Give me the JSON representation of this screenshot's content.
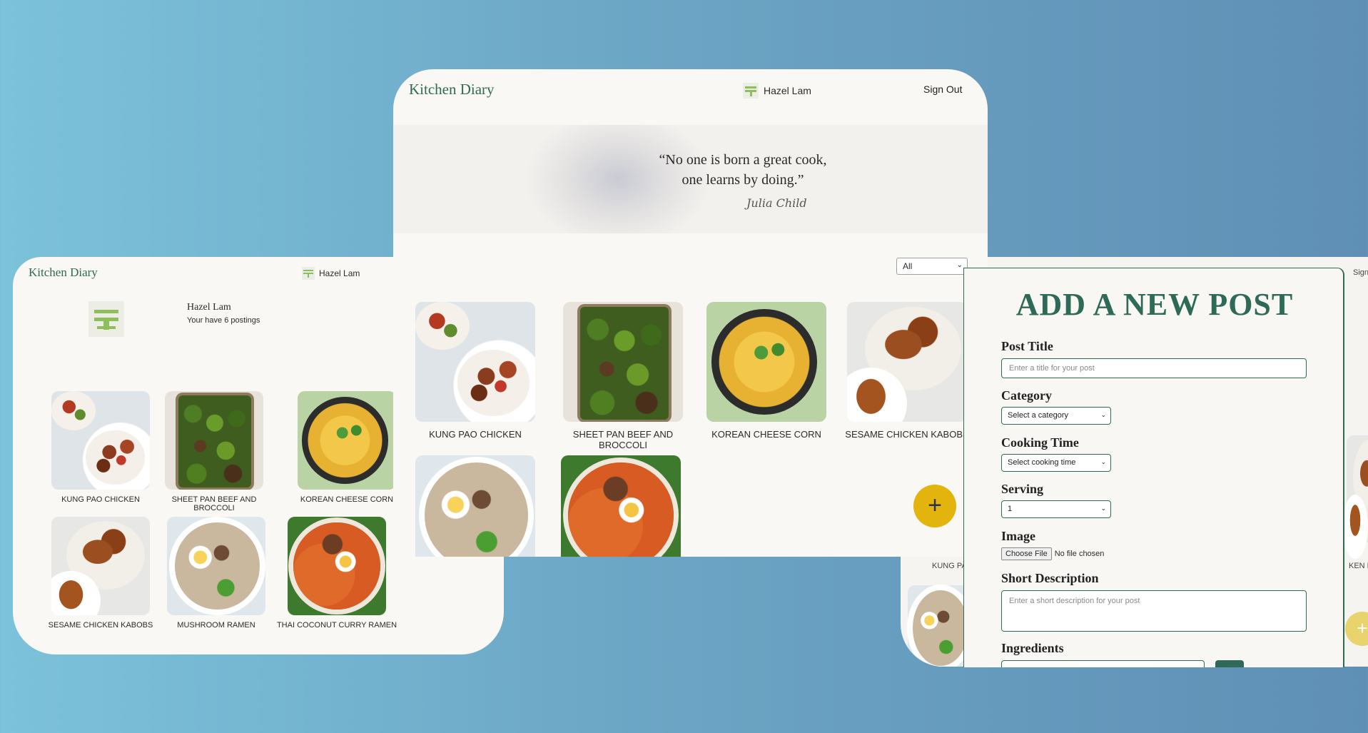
{
  "colors": {
    "brand_green": "#2e6a57",
    "fab_yellow": "#e2b40d",
    "card_bg": "#faf8f4"
  },
  "left": {
    "brand": "Kitchen Diary",
    "user_name": "Hazel Lam",
    "profile": {
      "name": "Hazel Lam",
      "count_text": "Your have 6 postings"
    },
    "recipes": [
      {
        "label": "KUNG PAO CHICKEN",
        "img": "kung-pao"
      },
      {
        "label": "SHEET PAN BEEF AND BROCCOLI",
        "img": "beef-broccoli"
      },
      {
        "label": "KOREAN CHEESE CORN",
        "img": "cheese-corn"
      },
      {
        "label": "SESAME CHICKEN KABOBS",
        "img": "kabobs"
      },
      {
        "label": "MUSHROOM RAMEN",
        "img": "mushroom-ramen"
      },
      {
        "label": "THAI COCONUT CURRY RAMEN",
        "img": "curry-ramen"
      }
    ]
  },
  "center": {
    "brand": "Kitchen Diary",
    "user_name": "Hazel Lam",
    "sign_out": "Sign Out",
    "quote_line1": "“No one is born a great cook,",
    "quote_line2": "one learns by doing.”",
    "quote_author": "Julia Child",
    "filter": {
      "selected": "All",
      "icon": "chevron-down-icon"
    },
    "recipes": [
      {
        "label": "KUNG PAO CHICKEN"
      },
      {
        "label": "SHEET PAN BEEF AND BROCCOLI"
      },
      {
        "label": "KOREAN CHEESE CORN"
      },
      {
        "label": "SESAME CHICKEN KABOBS"
      }
    ],
    "add_button": "+"
  },
  "right_back": {
    "sign_peek": "Sign",
    "label_peek_1": "KUNG PA",
    "label_peek_2": "KEN K",
    "fab": "+"
  },
  "form": {
    "title": "ADD A NEW POST",
    "post_title_label": "Post Title",
    "post_title_placeholder": "Enter a title for your post",
    "category_label": "Category",
    "category_value": "Select a category",
    "cooking_time_label": "Cooking Time",
    "cooking_time_value": "Select cooking time",
    "serving_label": "Serving",
    "serving_value": "1",
    "image_label": "Image",
    "file_button": "Choose File",
    "file_status": "No file chosen",
    "short_desc_label": "Short Description",
    "short_desc_placeholder": "Enter a short description for your post",
    "ingredients_label": "Ingredients"
  }
}
